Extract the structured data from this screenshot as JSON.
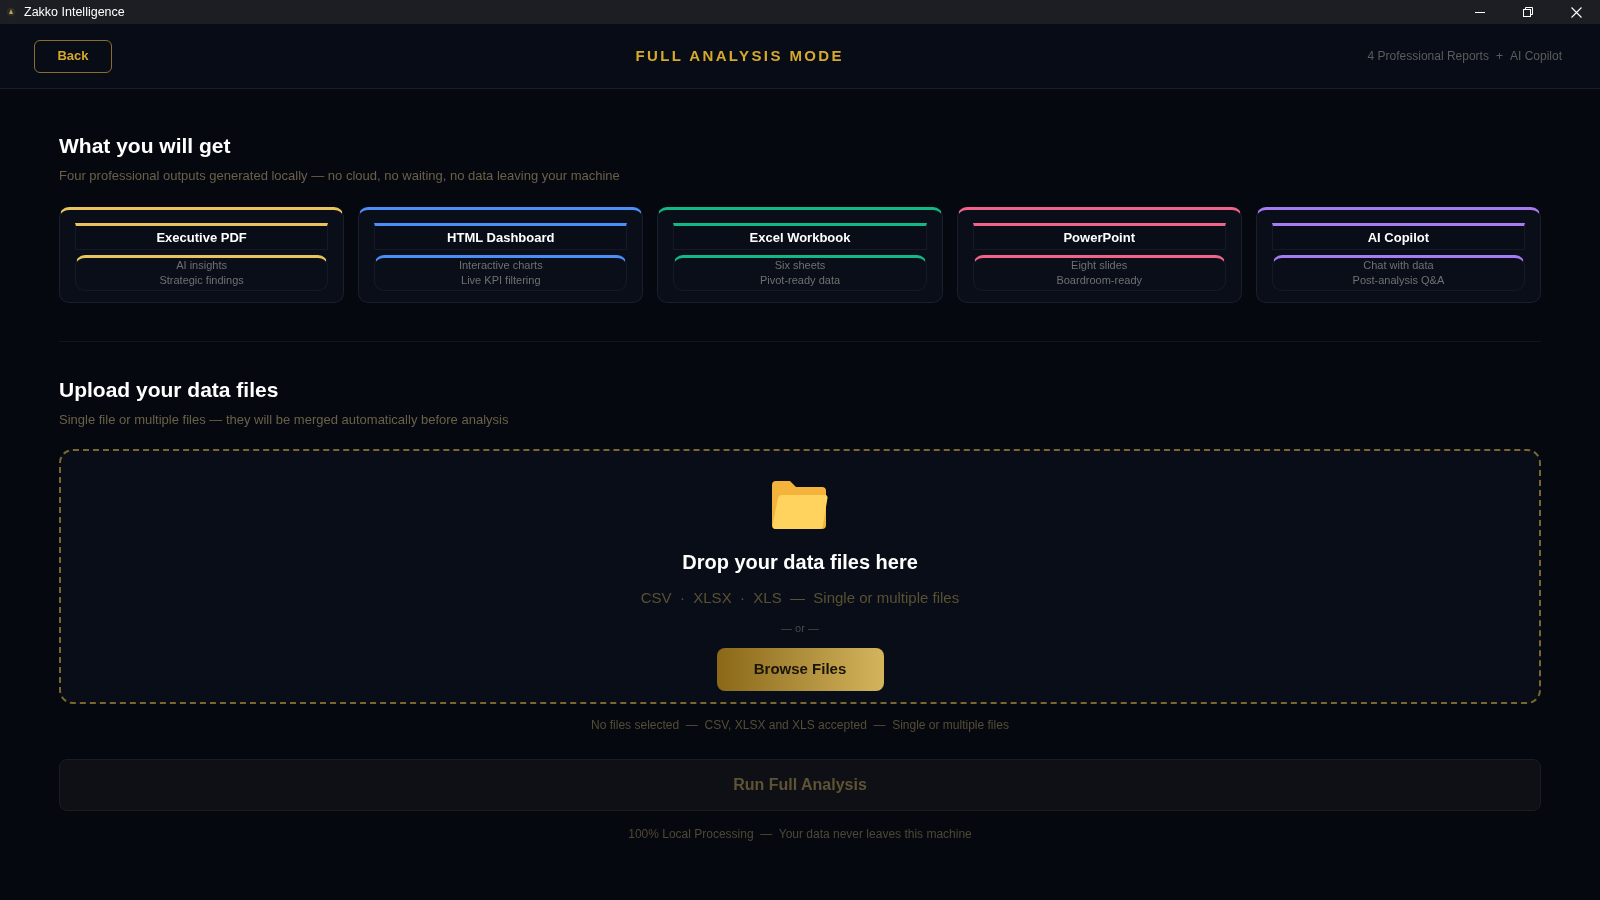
{
  "window": {
    "title": "Zakko Intelligence"
  },
  "header": {
    "back_button": "Back",
    "title": "FULL ANALYSIS MODE",
    "summary": [
      "4 Professional Reports",
      "+",
      "AI Copilot"
    ]
  },
  "outputs_section": {
    "heading": "What you will get",
    "subtitle": "Four professional outputs generated locally — no cloud, no waiting, no data leaving your machine",
    "cards": [
      {
        "title": "Executive PDF",
        "lines": [
          "AI insights",
          "Strategic findings"
        ],
        "color": "#e9c45c"
      },
      {
        "title": "HTML Dashboard",
        "lines": [
          "Interactive charts",
          "Live KPI filtering"
        ],
        "color": "#4c8ef7"
      },
      {
        "title": "Excel Workbook",
        "lines": [
          "Six sheets",
          "Pivot-ready data"
        ],
        "color": "#12b886"
      },
      {
        "title": "PowerPoint",
        "lines": [
          "Eight slides",
          "Boardroom-ready"
        ],
        "color": "#f0648c"
      },
      {
        "title": "AI Copilot",
        "lines": [
          "Chat with data",
          "Post-analysis Q&A"
        ],
        "color": "#a77bf2"
      }
    ]
  },
  "upload_section": {
    "heading": "Upload your data files",
    "subtitle": "Single file or multiple files — they will be merged automatically before analysis",
    "drop_zone": {
      "title": "Drop your data files here",
      "formats": "CSV  ·  XLSX  ·  XLS  —  Single or multiple files",
      "separator": "— or —",
      "browse_button": "Browse Files"
    },
    "status": "No files selected  —  CSV, XLSX and XLS accepted  —  Single or multiple files",
    "run_button": {
      "label": "Run Full Analysis",
      "disabled": true
    },
    "footer": "100% Local Processing  —  Your data never leaves this machine"
  }
}
